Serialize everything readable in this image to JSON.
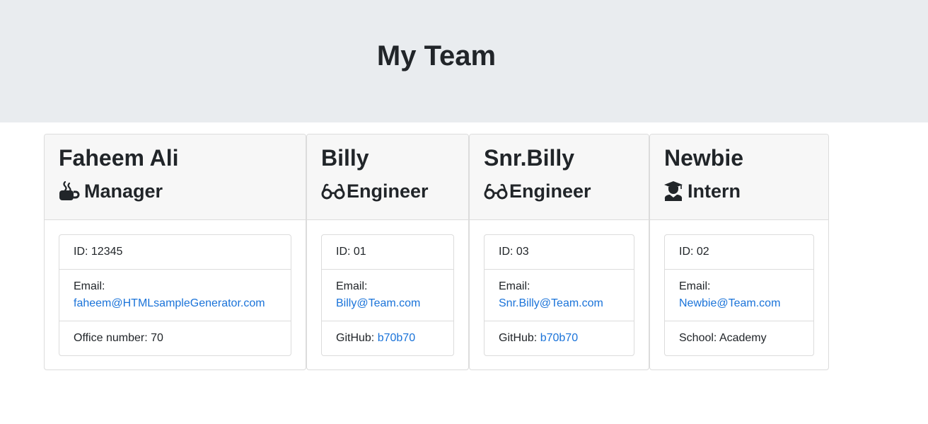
{
  "header": {
    "title": "My Team"
  },
  "team": [
    {
      "name": "Faheem Ali",
      "role": "Manager",
      "icon": "coffee-mug-icon",
      "id_label": "ID:",
      "id": "12345",
      "email_label": "Email:",
      "email": "faheem@HTMLsampleGenerator.com",
      "extra_label": "Office number:",
      "extra_value": "70"
    },
    {
      "name": "Billy",
      "role": "Engineer",
      "icon": "glasses-icon",
      "id_label": "ID:",
      "id": "01",
      "email_label": "Email:",
      "email": "Billy@Team.com",
      "extra_label": "GitHub:",
      "extra_value": "b70b70"
    },
    {
      "name": "Snr.Billy",
      "role": "Engineer",
      "icon": "glasses-icon",
      "id_label": "ID:",
      "id": "03",
      "email_label": "Email:",
      "email": "Snr.Billy@Team.com",
      "extra_label": "GitHub:",
      "extra_value": "b70b70"
    },
    {
      "name": "Newbie",
      "role": "Intern",
      "icon": "graduate-icon",
      "id_label": "ID:",
      "id": "02",
      "email_label": "Email:",
      "email": "Newbie@Team.com",
      "extra_label": "School:",
      "extra_value": "Academy"
    }
  ],
  "colors": {
    "link": "#1a73d9",
    "header_bg": "#e9ecef",
    "card_header_bg": "#f7f7f7",
    "text": "#212529"
  }
}
